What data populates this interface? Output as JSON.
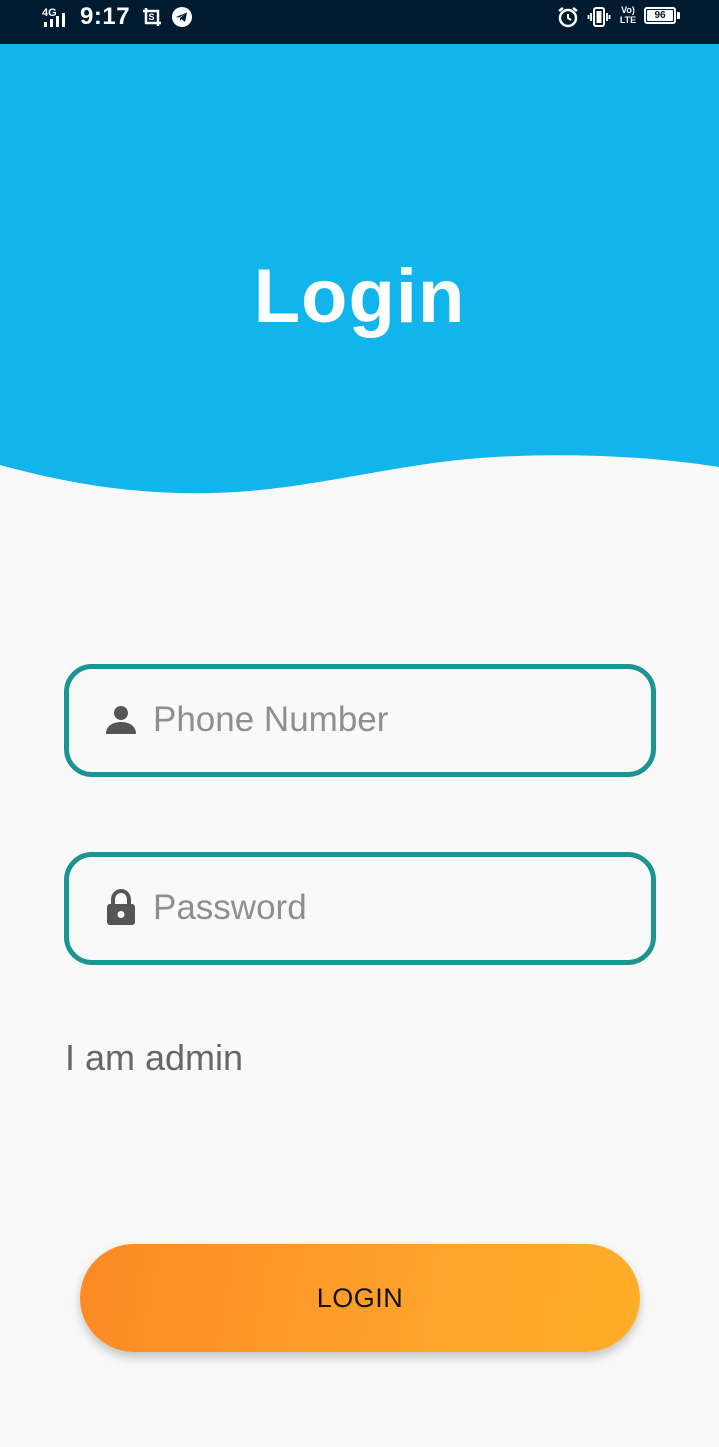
{
  "status_bar": {
    "network": "4G",
    "time": "9:17",
    "volte_line1": "Vo)",
    "volte_line2": "LTE",
    "battery": "96"
  },
  "icons": {
    "signal": "signal-icon",
    "screenshot": "screenshot-icon",
    "telegram": "telegram-icon",
    "alarm": "alarm-icon",
    "vibrate": "vibrate-icon",
    "volte": "volte-icon",
    "battery": "battery-icon",
    "person": "person-icon",
    "lock": "lock-icon"
  },
  "colors": {
    "header": "#12b5eb",
    "status_bar": "#001a30",
    "field_border": "#1c9490",
    "button_start": "#fd8a25",
    "button_end": "#feae29"
  },
  "header": {
    "title": "Login"
  },
  "form": {
    "phone": {
      "placeholder": "Phone Number",
      "value": ""
    },
    "password": {
      "placeholder": "Password",
      "value": ""
    },
    "admin_link": "I am admin",
    "login_button": "LOGIN"
  }
}
